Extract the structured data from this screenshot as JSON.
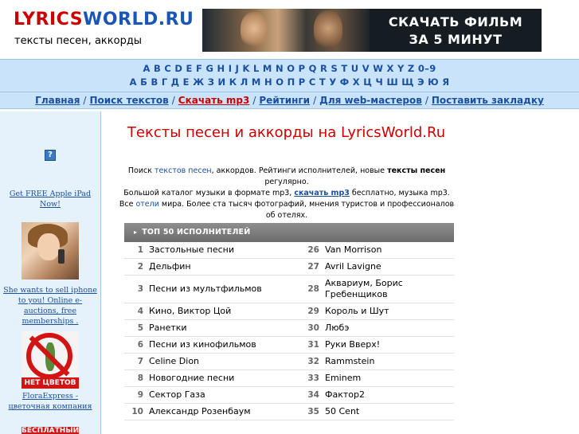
{
  "header": {
    "logo_part1": "LYRICS",
    "logo_part2": "WORLD.RU",
    "tagline": "тексты песен, аккорды",
    "banner_line1": "СКАЧАТЬ ФИЛЬМ",
    "banner_line2": "ЗА 5 МИНУТ"
  },
  "alphabet": {
    "latin": "A B C D E F G H I J K L M N O P Q R S T U V W X Y Z 0–9",
    "cyrillic": "А Б В Г Д Е Ж З И К Л М Н О П Р С Т У Ф Х Ц Ч Ш Щ Э Ю Я"
  },
  "nav": {
    "items": [
      "Главная",
      "Поиск текстов",
      "Скачать mp3",
      "Рейтинги",
      "Для web-мастеров",
      "Поставить закладку"
    ],
    "separator": "/"
  },
  "sidebar": {
    "help_icon": "?",
    "ad1": "Get FREE Apple iPad Now!",
    "ad2": "She wants to sell iphone to you! Online e-auctions, free memberships .",
    "ad3_image_label": "НЕТ ЦВЕТОВ",
    "ad3": "FloraExpress - цветочная компания",
    "ad4_image_label": "БЕСПЛАТНЫЙ"
  },
  "main": {
    "title": "Тексты песен и аккорды на LyricsWorld.Ru",
    "intro": {
      "p1": "Поиск ",
      "link1": "текстов песен",
      "p2": ", аккордов. Рейтинги исполнителей, новые ",
      "bold1": "тексты песен",
      "p3": " регулярно.",
      "p4": "Большой каталог музыки в формате mp3, ",
      "link2": "скачать mp3",
      "p5": " бесплатно, музыка mp3.",
      "p6": "Все ",
      "link3": "отели",
      "p7": " мира. Более ста тысяч фотографий, мнения туристов и профессионалов об отелях."
    },
    "top50": {
      "heading": "ТОП 50 ИСПОЛНИТЕЛЕЙ",
      "rows": [
        [
          {
            "n": "1",
            "name": "Застольные песни"
          },
          {
            "n": "26",
            "name": "Van Morrison"
          }
        ],
        [
          {
            "n": "2",
            "name": "Дельфин"
          },
          {
            "n": "27",
            "name": "Avril Lavigne"
          }
        ],
        [
          {
            "n": "3",
            "name": "Песни из мультфильмов"
          },
          {
            "n": "28",
            "name": "Аквариум, Борис Гребенщиков"
          }
        ],
        [
          {
            "n": "4",
            "name": "Кино, Виктор Цой"
          },
          {
            "n": "29",
            "name": "Король и Шут"
          }
        ],
        [
          {
            "n": "5",
            "name": "Ранетки"
          },
          {
            "n": "30",
            "name": "Любэ"
          }
        ],
        [
          {
            "n": "6",
            "name": "Песни из кинофильмов"
          },
          {
            "n": "31",
            "name": "Руки Вверх!"
          }
        ],
        [
          {
            "n": "7",
            "name": "Celine Dion"
          },
          {
            "n": "32",
            "name": "Rammstein"
          }
        ],
        [
          {
            "n": "8",
            "name": "Новогодние песни"
          },
          {
            "n": "33",
            "name": "Eminem"
          }
        ],
        [
          {
            "n": "9",
            "name": "Сектор Газа"
          },
          {
            "n": "34",
            "name": "Фактор2"
          }
        ],
        [
          {
            "n": "10",
            "name": "Александр Розенбаум"
          },
          {
            "n": "35",
            "name": "50 Cent"
          }
        ]
      ]
    }
  },
  "colors": {
    "logo_red": "#cc0000",
    "logo_blue": "#1a56b8",
    "band_bg": "#c9e4fa",
    "link_blue": "#1a4fa0",
    "title_red": "#cc0000"
  }
}
